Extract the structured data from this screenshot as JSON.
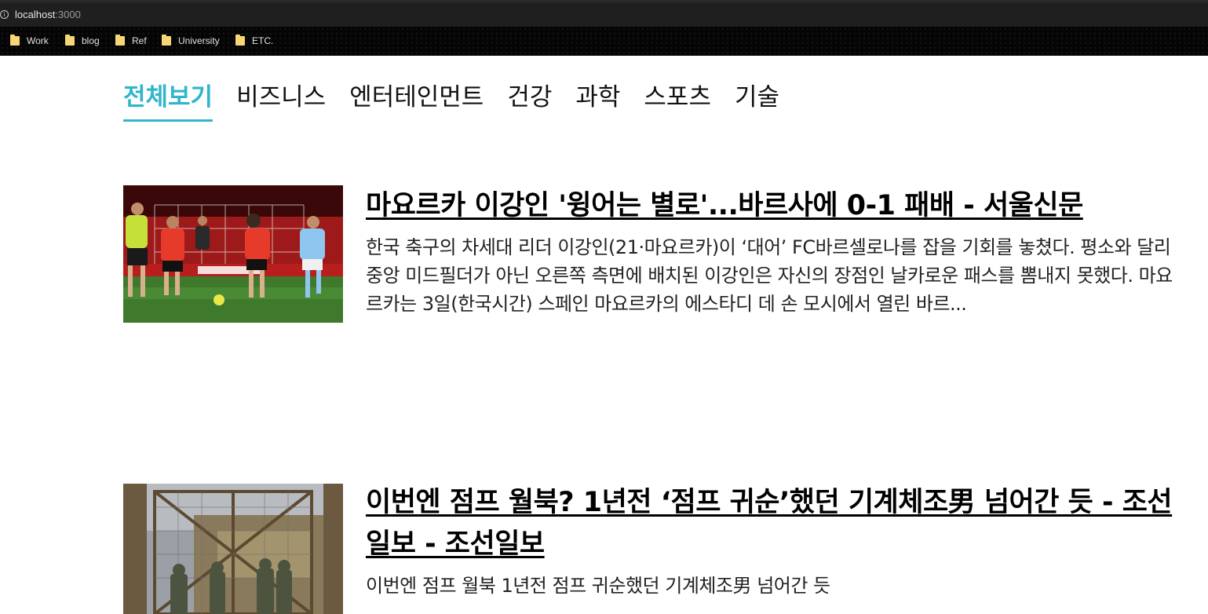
{
  "browser": {
    "url_host": "localhost",
    "url_port": ":3000",
    "bookmarks": [
      {
        "label": "Work"
      },
      {
        "label": "blog"
      },
      {
        "label": "Ref"
      },
      {
        "label": "University"
      },
      {
        "label": "ETC."
      }
    ]
  },
  "nav": {
    "tabs": [
      {
        "label": "전체보기",
        "active": true
      },
      {
        "label": "비즈니스"
      },
      {
        "label": "엔터테인먼트"
      },
      {
        "label": "건강"
      },
      {
        "label": "과학"
      },
      {
        "label": "스포츠"
      },
      {
        "label": "기술"
      }
    ],
    "accent_color": "#2fb6cc"
  },
  "articles": [
    {
      "title": "마요르카 이강인 '윙어는 별로'...바르사에 0-1 패배 - 서울신문",
      "description": "한국 축구의 차세대 리더 이강인(21·마요르카)이 ‘대어’ FC바르셀로나를 잡을 기회를 놓쳤다. 평소와 달리 중앙 미드필더가 아닌 오른쪽 측면에 배치된 이강인은 자신의 장점인 날카로운 패스를 뽐내지 못했다. 마요르카는 3일(한국시간) 스페인 마요르카의 에스타디 데 손 모시에서 열린 바르..."
    },
    {
      "title": "이번엔 점프 월북? 1년전 ‘점프 귀순’했던 기계체조男 넘어간 듯 - 조선일보 - 조선일보",
      "description": "이번엔 점프 월북 1년전 점프 귀순했던 기계체조男 넘어간 듯"
    }
  ]
}
